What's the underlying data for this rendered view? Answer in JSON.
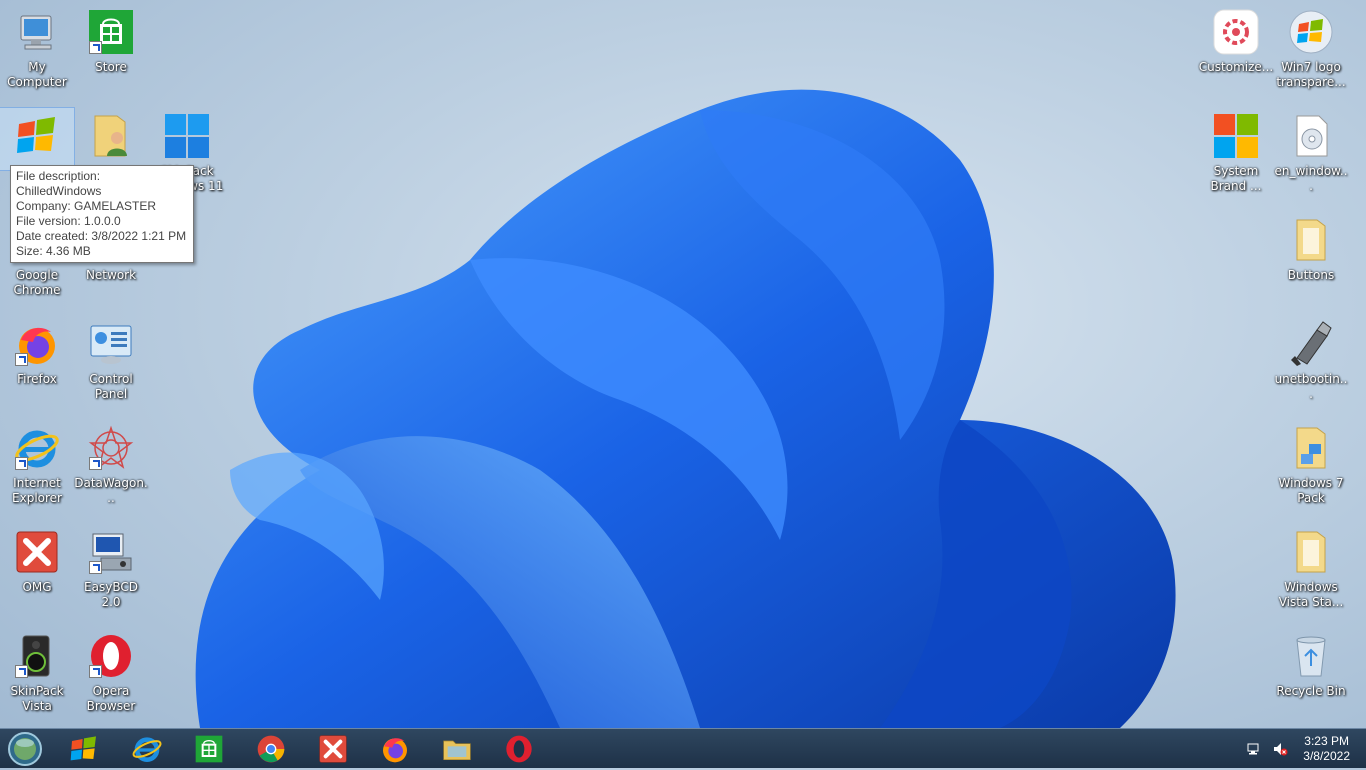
{
  "desktop_icons": {
    "my_computer": "My Computer",
    "store": "Store",
    "chilled_windows": "ChilledWindows",
    "user_folder": "",
    "skinpack": "SkinPack Windows 11",
    "google_chrome": "Google Chrome",
    "network": "Network",
    "firefox": "Firefox",
    "control_panel": "Control Panel",
    "internet_explorer": "Internet Explorer",
    "datawagon": "DataWagon...",
    "omg": "OMG",
    "easybcd": "EasyBCD 2.0",
    "skinpack_vista": "SkinPack Vista",
    "opera": "Opera Browser",
    "customize": "Customize...",
    "win7_logo": "Win7 logo transpare...",
    "system_brand": "System Brand ...",
    "en_windows": "en_window...",
    "buttons": "Buttons",
    "unetbootin": "unetbootin...",
    "win7_pack": "Windows 7 Pack",
    "vista_pack": "Windows Vista Sta...",
    "recycle_bin": "Recycle Bin"
  },
  "tooltip": {
    "line1": "File description: ChilledWindows",
    "line2": "Company: GAMELASTER",
    "line3": "File version: 1.0.0.0",
    "line4": "Date created: 3/8/2022 1:21 PM",
    "line5": "Size: 4.36 MB"
  },
  "clock": {
    "time": "3:23 PM",
    "date": "3/8/2022"
  },
  "colors": {
    "bloom": "#1a63e6",
    "taskbar": "#263b52"
  }
}
